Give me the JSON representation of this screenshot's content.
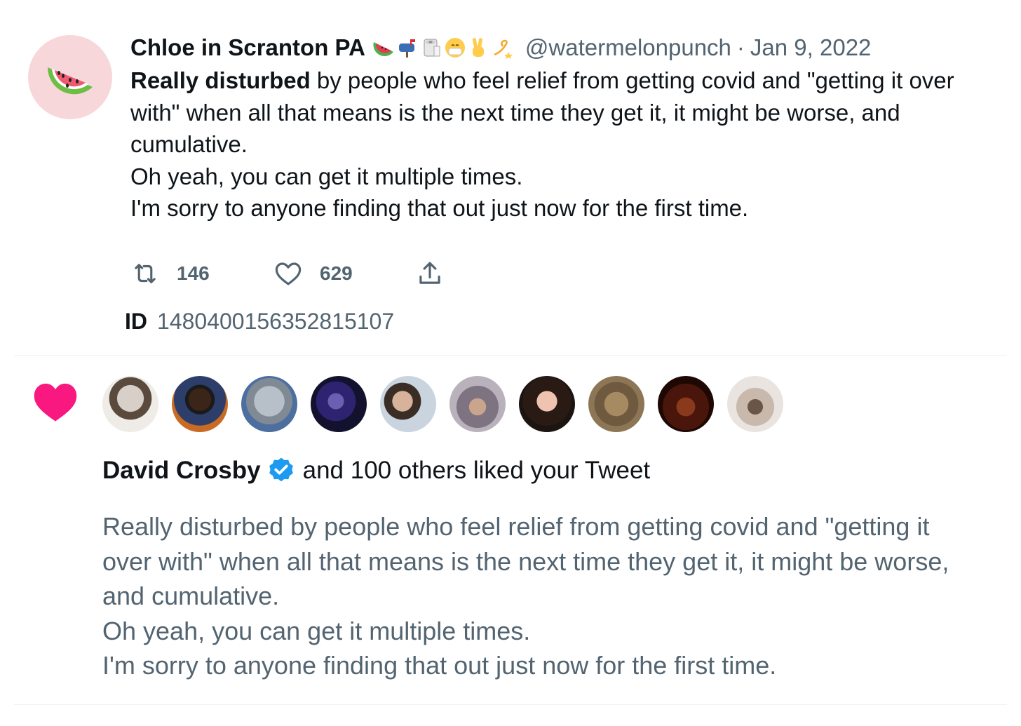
{
  "tweet": {
    "display_name": "Chloe in Scranton PA",
    "name_emojis": [
      "watermelon-icon",
      "mailbox-icon",
      "toilet-paper-icon",
      "mask-face-icon",
      "peace-hand-icon",
      "dizzy-icon"
    ],
    "handle": "@watermelonpunch",
    "separator": "·",
    "date": "Jan 9, 2022",
    "text_bold": "Really disturbed",
    "text_rest": " by people who feel relief from getting covid and \"getting it over with\" when all that means is the next time they get it, it might be worse, and cumulative.\nOh yeah, you can get it multiple times.\nI'm sorry to anyone finding that out just now for the first time.",
    "retweet_count": "146",
    "like_count": "629",
    "id_label": "ID",
    "id_value": "1480400156352815107"
  },
  "notification": {
    "liker_name": "David Crosby",
    "rest_text": "and 100 others liked your Tweet",
    "preview_text": "Really disturbed by people who feel relief from getting covid and \"getting it over with\" when all that means is the next time they get it, it might be worse, and cumulative.\nOh yeah, you can get it multiple times.\nI'm sorry to anyone finding that out just now for the first time.",
    "avatar_count": 10
  },
  "colors": {
    "text_primary": "#0f1419",
    "text_secondary": "#536471",
    "like_pink": "#f91880",
    "verified_blue": "#1d9bf0",
    "divider": "#eff3f4"
  }
}
